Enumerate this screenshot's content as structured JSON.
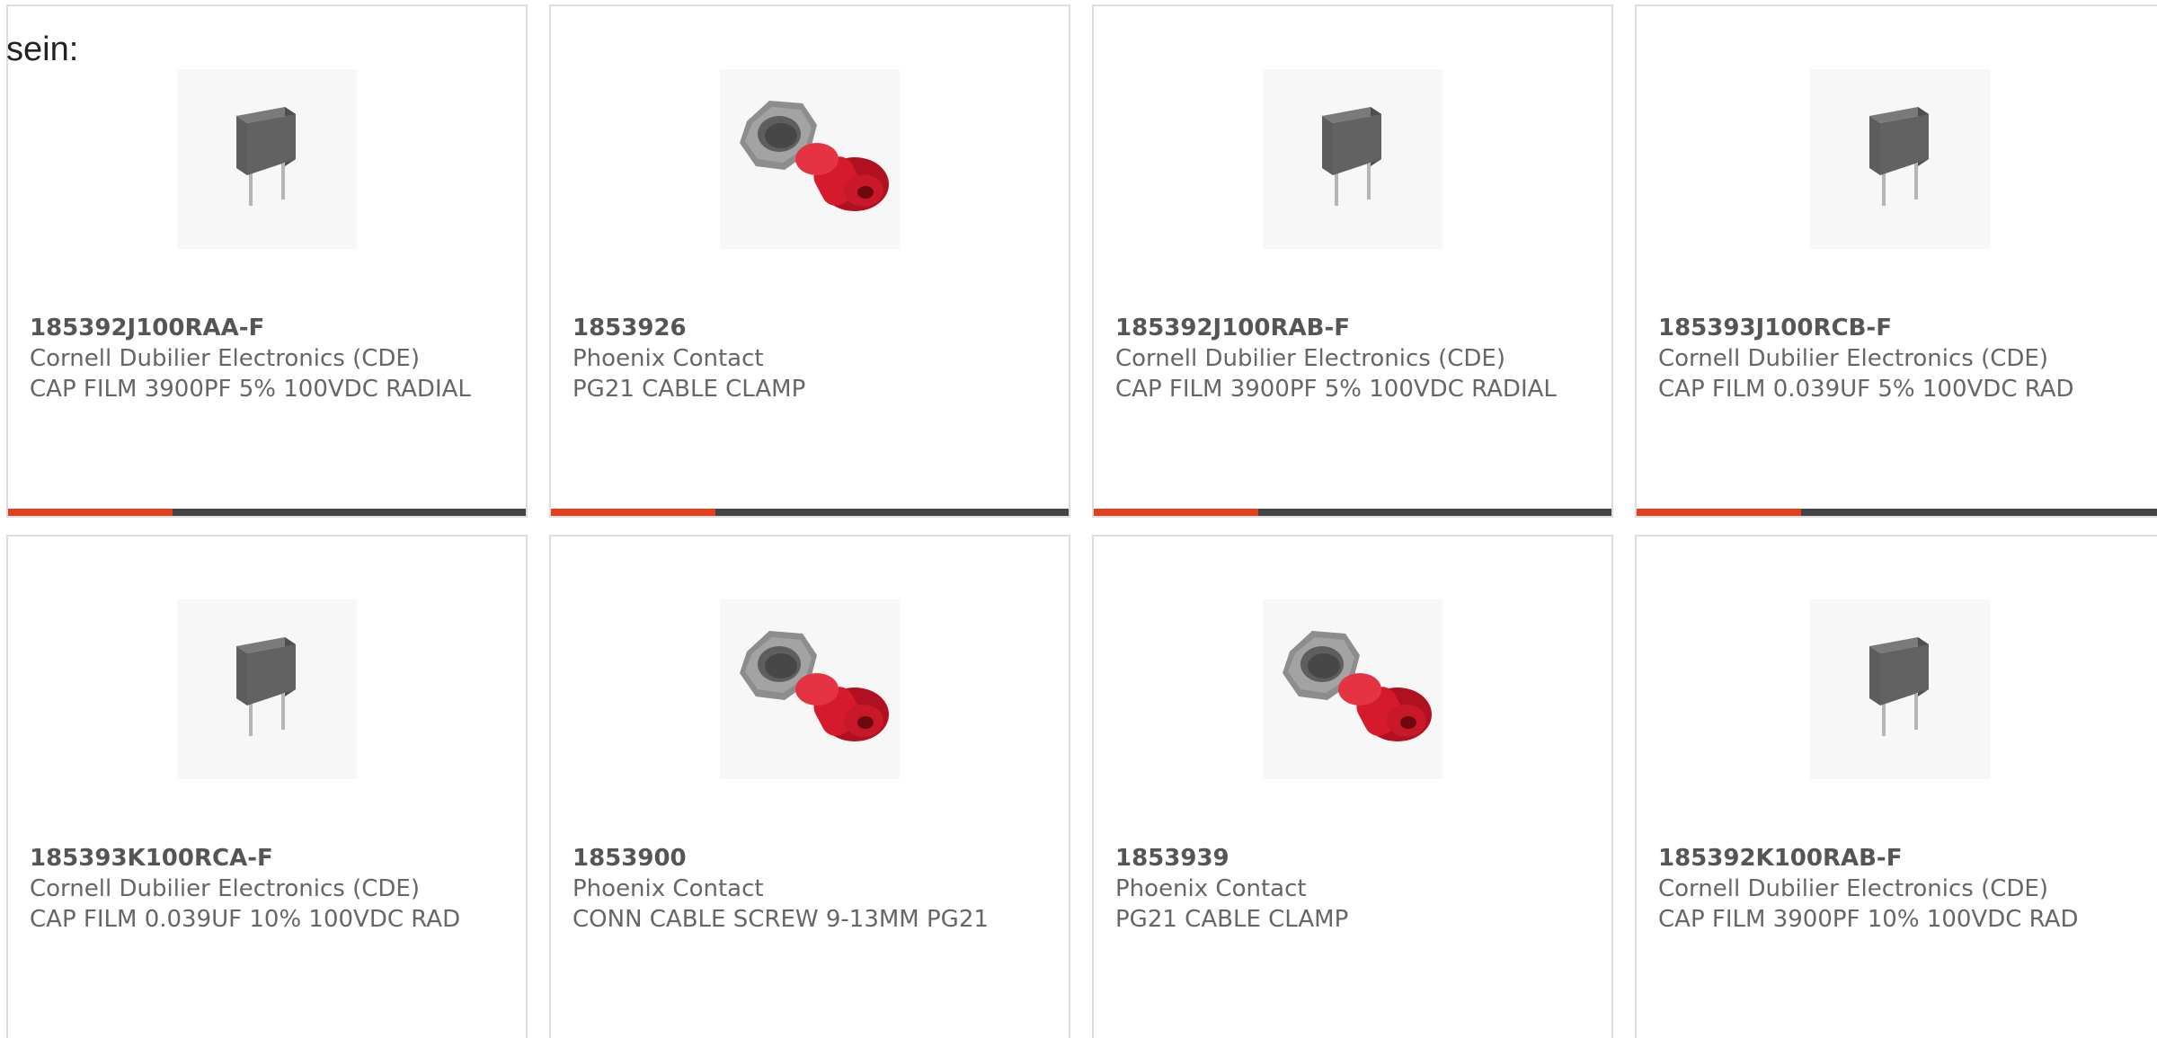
{
  "intro_text": "sein:",
  "colors": {
    "accent": "#e2401c",
    "bar": "#444444",
    "border": "#dddddd"
  },
  "products": [
    {
      "part_number": "185392J100RAA-F",
      "manufacturer": "Cornell Dubilier Electronics (CDE)",
      "description": "CAP FILM 3900PF 5% 100VDC RADIAL",
      "image": "film-capacitor-image"
    },
    {
      "part_number": "1853926",
      "manufacturer": "Phoenix Contact",
      "description": "PG21 CABLE CLAMP",
      "image": "cable-clamp-image"
    },
    {
      "part_number": "185392J100RAB-F",
      "manufacturer": "Cornell Dubilier Electronics (CDE)",
      "description": "CAP FILM 3900PF 5% 100VDC RADIAL",
      "image": "film-capacitor-image"
    },
    {
      "part_number": "185393J100RCB-F",
      "manufacturer": "Cornell Dubilier Electronics (CDE)",
      "description": "CAP FILM 0.039UF 5% 100VDC RAD",
      "image": "film-capacitor-image"
    },
    {
      "part_number": "185393K100RCA-F",
      "manufacturer": "Cornell Dubilier Electronics (CDE)",
      "description": "CAP FILM 0.039UF 10% 100VDC RAD",
      "image": "film-capacitor-image"
    },
    {
      "part_number": "1853900",
      "manufacturer": "Phoenix Contact",
      "description": "CONN CABLE SCREW 9-13MM PG21",
      "image": "cable-clamp-image"
    },
    {
      "part_number": "1853939",
      "manufacturer": "Phoenix Contact",
      "description": "PG21 CABLE CLAMP",
      "image": "cable-clamp-image"
    },
    {
      "part_number": "185392K100RAB-F",
      "manufacturer": "Cornell Dubilier Electronics (CDE)",
      "description": "CAP FILM 3900PF 10% 100VDC RAD",
      "image": "film-capacitor-image"
    }
  ]
}
